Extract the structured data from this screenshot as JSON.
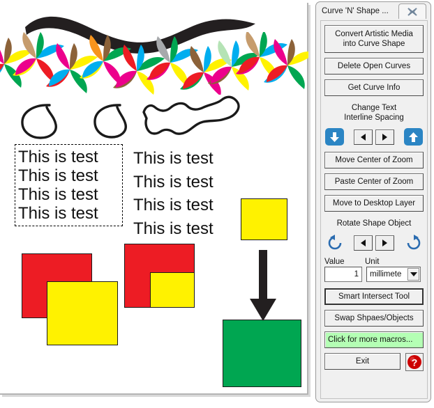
{
  "panel": {
    "title": "Curve 'N' Shape ...",
    "close_icon": "close-x-icon",
    "buttons": {
      "convert": "Convert Artistic Media into Curve Shape",
      "convert_l1": "Convert Artistic Media",
      "convert_l2": "into Curve Shape",
      "delete_open_curves": "Delete Open Curves",
      "get_curve_info": "Get Curve Info",
      "move_center_zoom": "Move Center of Zoom",
      "paste_center_zoom": "Paste Center of Zoom",
      "move_desktop_layer": "Move to Desktop Layer",
      "smart_intersect": "Smart Intersect Tool",
      "swap_shapes": "Swap Shpaes/Objects",
      "more_macros": "Click for more macros...",
      "exit": "Exit"
    },
    "sections": {
      "interline_l1": "Change Text",
      "interline_l2": "Interline Spacing",
      "rotate": "Rotate Shape Object"
    },
    "interline_controls": {
      "decrease_icon": "arrow-down-icon",
      "prev_icon": "triangle-left-icon",
      "next_icon": "triangle-right-icon",
      "increase_icon": "arrow-up-icon"
    },
    "rotate_controls": {
      "ccw_icon": "rotate-counterclockwise-icon",
      "prev_icon": "triangle-left-icon",
      "next_icon": "triangle-right-icon",
      "cw_icon": "rotate-clockwise-icon"
    },
    "value_field": {
      "label": "Value",
      "value": "1"
    },
    "unit_field": {
      "label": "Unit",
      "value": "millimete",
      "dropdown_icon": "chevron-down-icon"
    },
    "help_icon": "help-question-icon",
    "colors": {
      "panel_bg": "#f0f0f0",
      "accent_blue": "#2b85c4",
      "macros_green": "#b4ffb4",
      "help_red": "#cc0000"
    }
  },
  "canvas": {
    "text_block_selected": {
      "lines": [
        "This is test",
        "This is test",
        "This is test",
        "This is test"
      ]
    },
    "text_block_plain": {
      "lines": [
        "This is test",
        "This is test",
        "This is test",
        "This is test"
      ]
    },
    "artwork": {
      "brush_stroke": "black-wavy-brush-stroke",
      "swirls": "colorful-pinwheel-swirl-band",
      "open_curve_1": "open-loop-curve",
      "open_curve_2": "open-loop-curve",
      "blob_curve": "wavy-closed-blob-curve"
    },
    "shapes": {
      "red_1": "#ed1c24",
      "yellow_1": "#fff200",
      "red_2": "#ed1c24",
      "yellow_2": "#fff200",
      "yellow_3": "#fff200",
      "green_1": "#00a651",
      "arrow": "down-arrow-shape"
    }
  }
}
